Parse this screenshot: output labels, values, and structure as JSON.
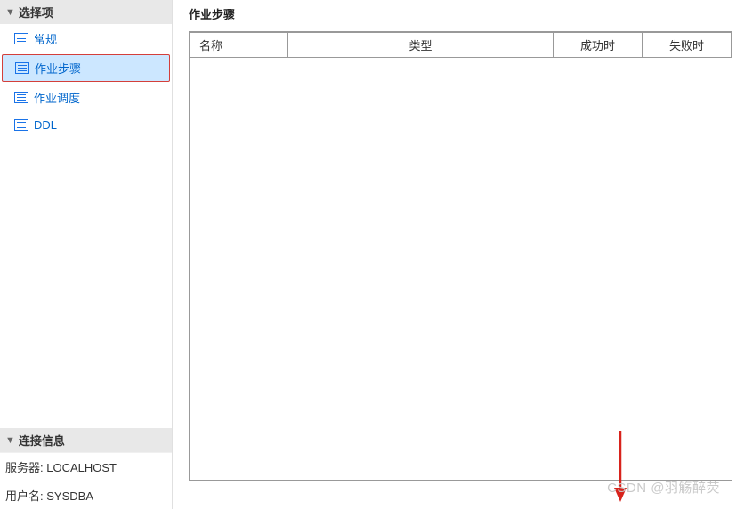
{
  "sidebar": {
    "options_header": "选择项",
    "items": [
      {
        "label": "常规"
      },
      {
        "label": "作业步骤"
      },
      {
        "label": "作业调度"
      },
      {
        "label": "DDL"
      }
    ],
    "connection_header": "连接信息",
    "server_label": "服务器:",
    "server_value": "LOCALHOST",
    "user_label": "用户名:",
    "user_value": "SYSDBA"
  },
  "main": {
    "title": "作业步骤",
    "columns": {
      "name": "名称",
      "type": "类型",
      "success": "成功时",
      "fail": "失败时"
    }
  },
  "watermark": "CSDN @羽觞醉荧"
}
